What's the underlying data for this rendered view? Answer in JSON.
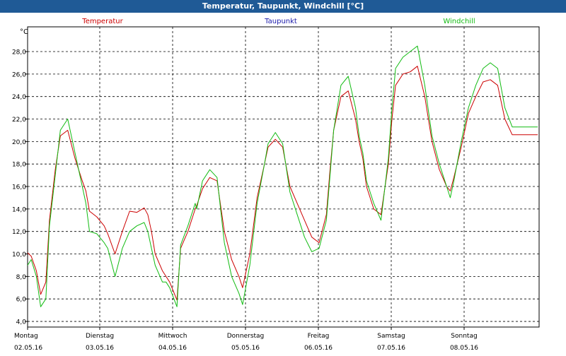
{
  "window": {
    "title": "Temperatur, Taupunkt, Windchill [°C]"
  },
  "colors": {
    "title_bar": "#1f5a96",
    "temperatur": "#cc0000",
    "taupunkt": "#1a1aaa",
    "windchill": "#11bb11",
    "grid": "#000000"
  },
  "chart_data": {
    "type": "line",
    "title": "Temperatur, Taupunkt, Windchill [°C]",
    "ylabel": "°C",
    "ylim": [
      3.5,
      30.2
    ],
    "xlim": [
      0,
      7
    ],
    "grid": true,
    "legend_position": "top",
    "legend": [
      "Temperatur",
      "Taupunkt",
      "Windchill"
    ],
    "y_ticks": [
      "4,0",
      "6,0",
      "8,0",
      "10,0",
      "12,0",
      "14,0",
      "16,0",
      "18,0",
      "20,0",
      "22,0",
      "24,0",
      "26,0",
      "28,0"
    ],
    "x_ticks": [
      {
        "day": "Montag",
        "date": "02.05.16"
      },
      {
        "day": "Dienstag",
        "date": "03.05.16"
      },
      {
        "day": "Mittwoch",
        "date": "04.05.16"
      },
      {
        "day": "Donnerstag",
        "date": "05.05.16"
      },
      {
        "day": "Freitag",
        "date": "06.05.16"
      },
      {
        "day": "Samstag",
        "date": "07.05.16"
      },
      {
        "day": "Sonntag",
        "date": "08.05.16"
      }
    ],
    "series": [
      {
        "name": "Temperatur",
        "x": [
          0,
          0.05,
          0.12,
          0.18,
          0.25,
          0.3,
          0.38,
          0.45,
          0.55,
          0.65,
          0.75,
          0.8,
          0.85,
          0.95,
          1.05,
          1.1,
          1.2,
          1.3,
          1.4,
          1.5,
          1.6,
          1.65,
          1.7,
          1.75,
          1.85,
          1.9,
          1.95,
          2.05,
          2.1,
          2.2,
          2.3,
          2.32,
          2.4,
          2.5,
          2.6,
          2.7,
          2.8,
          2.9,
          2.95,
          3.05,
          3.15,
          3.25,
          3.3,
          3.4,
          3.5,
          3.6,
          3.7,
          3.8,
          3.9,
          4.0,
          4.1,
          4.15,
          4.2,
          4.3,
          4.4,
          4.5,
          4.55,
          4.6,
          4.65,
          4.75,
          4.85,
          4.95,
          5.0,
          5.05,
          5.15,
          5.25,
          5.35,
          5.45,
          5.55,
          5.65,
          5.75,
          5.8,
          5.85,
          5.95,
          6.05,
          6.15,
          6.25,
          6.35,
          6.45,
          6.55,
          6.65,
          6.75,
          6.85,
          6.95,
          7.0
        ],
        "y": [
          10.1,
          9.8,
          8.5,
          6.4,
          7.5,
          13.0,
          17.5,
          20.5,
          21.0,
          18.5,
          16.5,
          15.6,
          13.8,
          13.3,
          12.5,
          11.8,
          10.0,
          12.0,
          13.8,
          13.7,
          14.1,
          13.5,
          12.0,
          10.0,
          8.5,
          8.0,
          7.5,
          5.9,
          10.5,
          12.0,
          14.0,
          14.3,
          15.8,
          16.8,
          16.5,
          12.0,
          9.5,
          8.0,
          7.0,
          10.0,
          15.0,
          18.0,
          19.5,
          20.2,
          19.5,
          16.0,
          14.5,
          13.0,
          11.5,
          11.0,
          13.5,
          17.5,
          21.0,
          24.0,
          24.5,
          22.0,
          20.0,
          18.5,
          16.0,
          14.0,
          13.5,
          18.0,
          22.0,
          25.0,
          26.0,
          26.2,
          26.7,
          24.0,
          20.0,
          17.5,
          16.0,
          15.6,
          16.8,
          19.5,
          22.5,
          24.0,
          25.3,
          25.5,
          25.0,
          22.0,
          20.6,
          20.6,
          20.6,
          20.6,
          20.6
        ]
      },
      {
        "name": "Windchill",
        "x": [
          0,
          0.05,
          0.12,
          0.18,
          0.25,
          0.3,
          0.38,
          0.45,
          0.55,
          0.65,
          0.75,
          0.8,
          0.85,
          0.95,
          1.05,
          1.1,
          1.2,
          1.3,
          1.4,
          1.5,
          1.6,
          1.65,
          1.7,
          1.75,
          1.85,
          1.9,
          1.95,
          2.05,
          2.1,
          2.2,
          2.3,
          2.32,
          2.4,
          2.5,
          2.6,
          2.7,
          2.8,
          2.9,
          2.95,
          3.05,
          3.15,
          3.25,
          3.3,
          3.4,
          3.5,
          3.6,
          3.7,
          3.8,
          3.9,
          4.0,
          4.1,
          4.15,
          4.2,
          4.3,
          4.4,
          4.5,
          4.55,
          4.6,
          4.65,
          4.75,
          4.85,
          4.95,
          5.0,
          5.05,
          5.15,
          5.25,
          5.35,
          5.45,
          5.55,
          5.65,
          5.75,
          5.8,
          5.85,
          5.95,
          6.05,
          6.15,
          6.25,
          6.35,
          6.45,
          6.55,
          6.65,
          6.75,
          6.85,
          6.95,
          7.0
        ],
        "y": [
          9.0,
          9.5,
          8.0,
          5.3,
          6.0,
          12.5,
          17.0,
          21.0,
          22.0,
          19.0,
          16.0,
          14.5,
          12.0,
          11.8,
          11.0,
          10.5,
          8.0,
          10.5,
          12.0,
          12.5,
          12.8,
          12.0,
          10.5,
          9.0,
          7.5,
          7.5,
          7.0,
          5.3,
          10.8,
          12.5,
          14.5,
          14.0,
          16.5,
          17.5,
          16.8,
          11.0,
          8.0,
          6.5,
          5.5,
          9.0,
          14.5,
          18.0,
          19.8,
          20.8,
          19.8,
          15.5,
          13.5,
          11.5,
          10.2,
          10.5,
          13.0,
          17.0,
          21.0,
          25.0,
          25.8,
          23.0,
          20.5,
          19.0,
          16.5,
          14.5,
          13.0,
          18.5,
          23.0,
          26.5,
          27.5,
          28.0,
          28.5,
          25.0,
          20.5,
          18.0,
          16.0,
          15.0,
          16.5,
          20.0,
          23.0,
          25.0,
          26.5,
          27.0,
          26.5,
          23.0,
          21.3,
          21.3,
          21.3,
          21.3,
          21.3
        ]
      }
    ]
  }
}
